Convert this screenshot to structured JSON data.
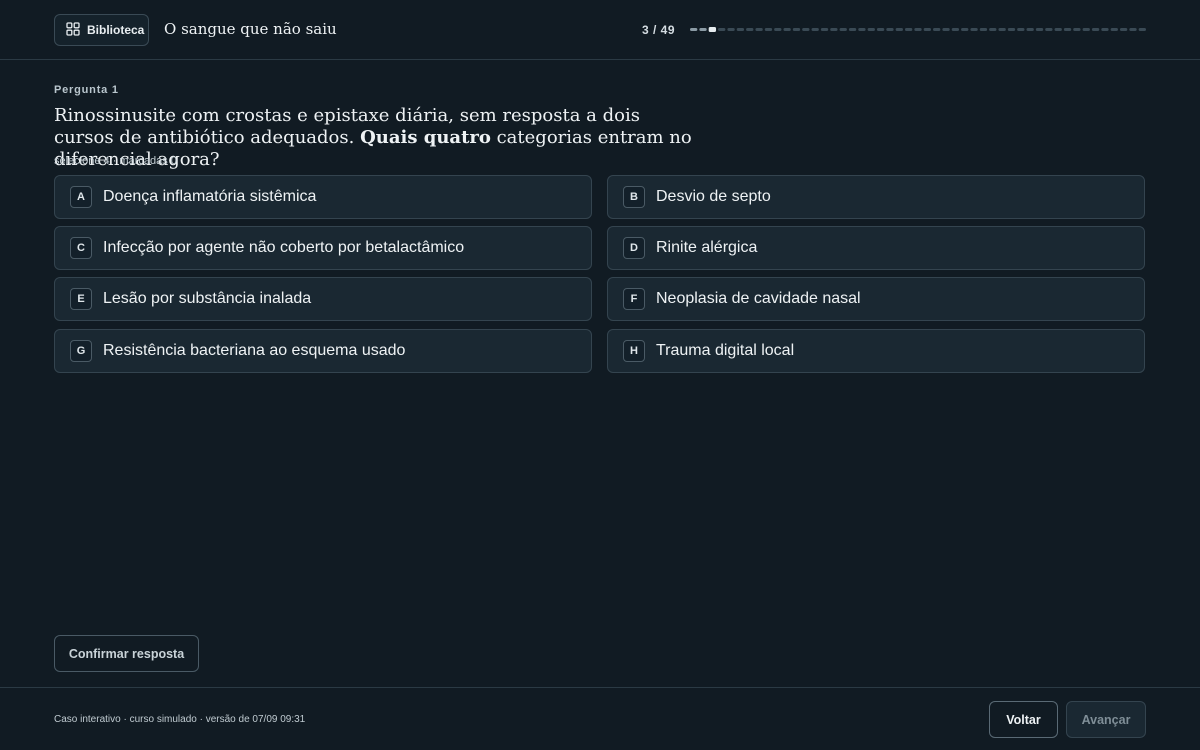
{
  "header": {
    "library_label": "Biblioteca",
    "case_title": "O sangue que não saiu",
    "progress_text": "3 / 49",
    "progress_total": 49,
    "progress_current": 3,
    "icons": {
      "library": "grid-icon"
    }
  },
  "question": {
    "kicker": "Pergunta 1",
    "text_before": "Rinossinusite com crostas e epistaxe diária, sem resposta a dois cursos de antibiótico adequados. ",
    "text_emphasis": "Quais quatro",
    "text_after": " categorias entram no diferencial agora?",
    "meta": "selecione 4 · marcadas 0"
  },
  "options": [
    {
      "letter": "A",
      "label": "Doença inflamatória sistêmica"
    },
    {
      "letter": "B",
      "label": "Desvio de septo"
    },
    {
      "letter": "C",
      "label": "Infecção por agente não coberto por betalactâmico"
    },
    {
      "letter": "D",
      "label": "Rinite alérgica"
    },
    {
      "letter": "E",
      "label": "Lesão por substância inalada"
    },
    {
      "letter": "F",
      "label": "Neoplasia de cavidade nasal"
    },
    {
      "letter": "G",
      "label": "Resistência bacteriana ao esquema usado"
    },
    {
      "letter": "H",
      "label": "Trauma digital local"
    }
  ],
  "actions": {
    "confirm_label": "Confirmar resposta",
    "back_label": "Voltar",
    "next_label": "Avançar"
  },
  "footer": {
    "note": "Caso interativo · curso simulado · versão de 07/09 09:31"
  },
  "colors": {
    "background": "#111b23",
    "card": "#1a2832",
    "border": "#34444f",
    "progress_done": "#8b9ba5",
    "progress_current": "#e6ecef",
    "progress_todo": "#3a4a55"
  }
}
